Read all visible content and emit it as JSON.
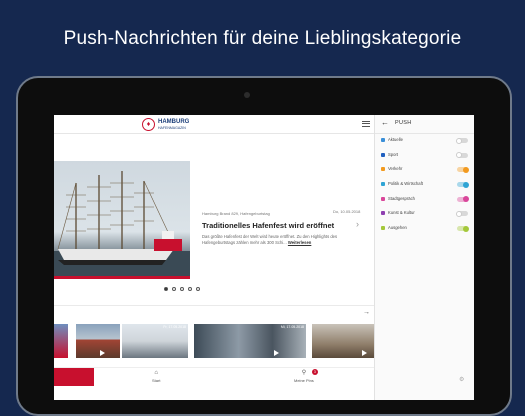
{
  "headline": "Push-Nachrichten für deine Lieblingskategorie",
  "app": {
    "logo_name": "HAMBURG",
    "logo_sub": "HAFENMAGAZIN"
  },
  "hero": {
    "meta": "Hamburg Brand 829, Hafengeburtstag",
    "date": "Do, 10.05.2018",
    "title": "Traditionelles Hafenfest wird eröffnet",
    "teaser": "Das größte Hafenfest der Welt wird heute eröffnet. Zu den Highlights des Hafengeburtstags zählen mehr als 300 Schi...",
    "more": "Weiterlesen",
    "slide_count": 5,
    "active_slide": 1
  },
  "thumbs": [
    {
      "date": ""
    },
    {
      "date": ""
    },
    {
      "date": "Fr, 17.05.2018"
    },
    {
      "date": "Mi, 17.05.2018"
    },
    {
      "date": ""
    }
  ],
  "nav": [
    {
      "label": "Start",
      "icon": "home-icon"
    },
    {
      "label": "Meine Pins",
      "icon": "pin-icon",
      "badge": "3"
    }
  ],
  "panel": {
    "title": "PUSH",
    "categories": [
      {
        "label": "Aktuelle",
        "color": "#3a8fd8",
        "on": false
      },
      {
        "label": "Sport",
        "color": "#1f5fbf",
        "on": false
      },
      {
        "label": "Verkehr",
        "color": "#f29a1f",
        "on": true
      },
      {
        "label": "Politik & Wirtschaft",
        "color": "#2fa4d4",
        "on": true
      },
      {
        "label": "Stadtgespräch",
        "color": "#d9469a",
        "on": true
      },
      {
        "label": "Kunst & Kultur",
        "color": "#8e3fb0",
        "on": false
      },
      {
        "label": "Ausgehen",
        "color": "#a4c83a",
        "on": true
      }
    ]
  }
}
